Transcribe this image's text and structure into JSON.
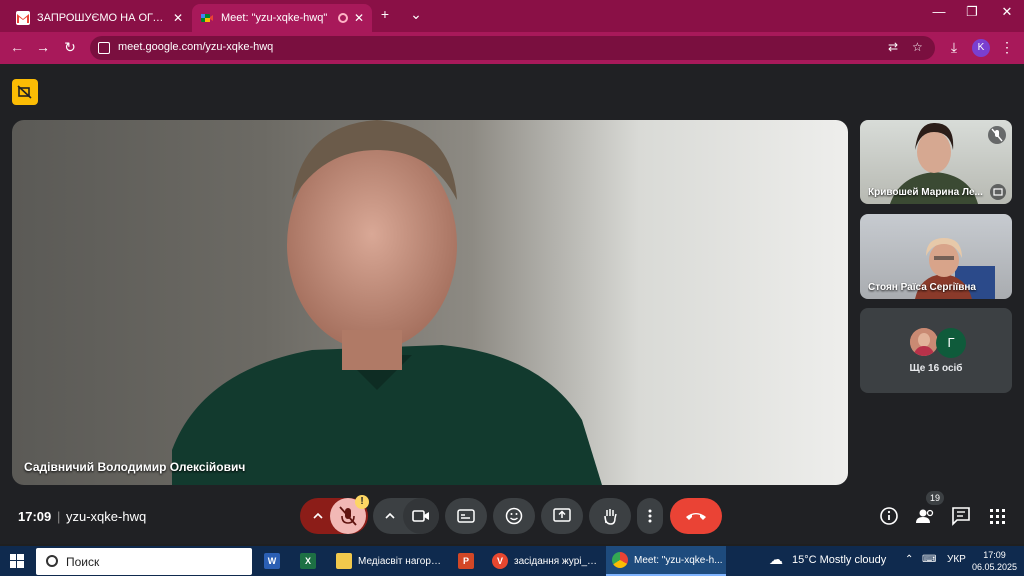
{
  "browser": {
    "tabs": [
      {
        "title": "ЗАПРОШУЄМО НА ОГОЛОШЕ"
      },
      {
        "title": "Meet: \"yzu-xqke-hwq\""
      }
    ],
    "new_tab": "+",
    "close_glyph": "✕",
    "url": "meet.google.com/yzu-xqke-hwq",
    "profile_initial": "K",
    "colors": {
      "frame": "#8a1046",
      "toolbar": "#a8195a"
    }
  },
  "meet": {
    "main_participant": "Садівничий Володимир Олексійович",
    "side_participants": [
      {
        "name": "Кривошей Марина Ле..."
      },
      {
        "name": "Стоян Раїса Сергіївна"
      }
    ],
    "more": {
      "avatar_letter": "Г",
      "label": "Ще 16 осіб"
    },
    "bottom": {
      "time": "17:09",
      "separator": "|",
      "meeting_code": "yzu-xqke-hwq",
      "participants_count": "19",
      "mic_warning": "!"
    },
    "colors": {
      "hangup": "#ea4335",
      "mic_off": "#f2b8b5",
      "warning": "#fbbc04"
    }
  },
  "taskbar": {
    "search_placeholder": "Поиск",
    "apps": [
      {
        "label": "",
        "icon_text": "W",
        "color": "#2b5fb4"
      },
      {
        "label": "",
        "icon_text": "X",
        "color": "#1d7044"
      },
      {
        "label": "Медіасвіт нагород...",
        "icon_text": "",
        "color": "#f2c94c"
      },
      {
        "label": "",
        "icon_text": "P",
        "color": "#d24726"
      },
      {
        "label": "засідання журі_під...",
        "icon_text": "V",
        "color": "#e8472f"
      },
      {
        "label": "Meet: \"yzu-xqke-h...",
        "icon_text": "",
        "color": "#4285f4"
      }
    ],
    "weather": "15°C  Mostly cloudy",
    "language": "УКР",
    "clock_time": "17:09",
    "clock_date": "06.05.2025"
  }
}
